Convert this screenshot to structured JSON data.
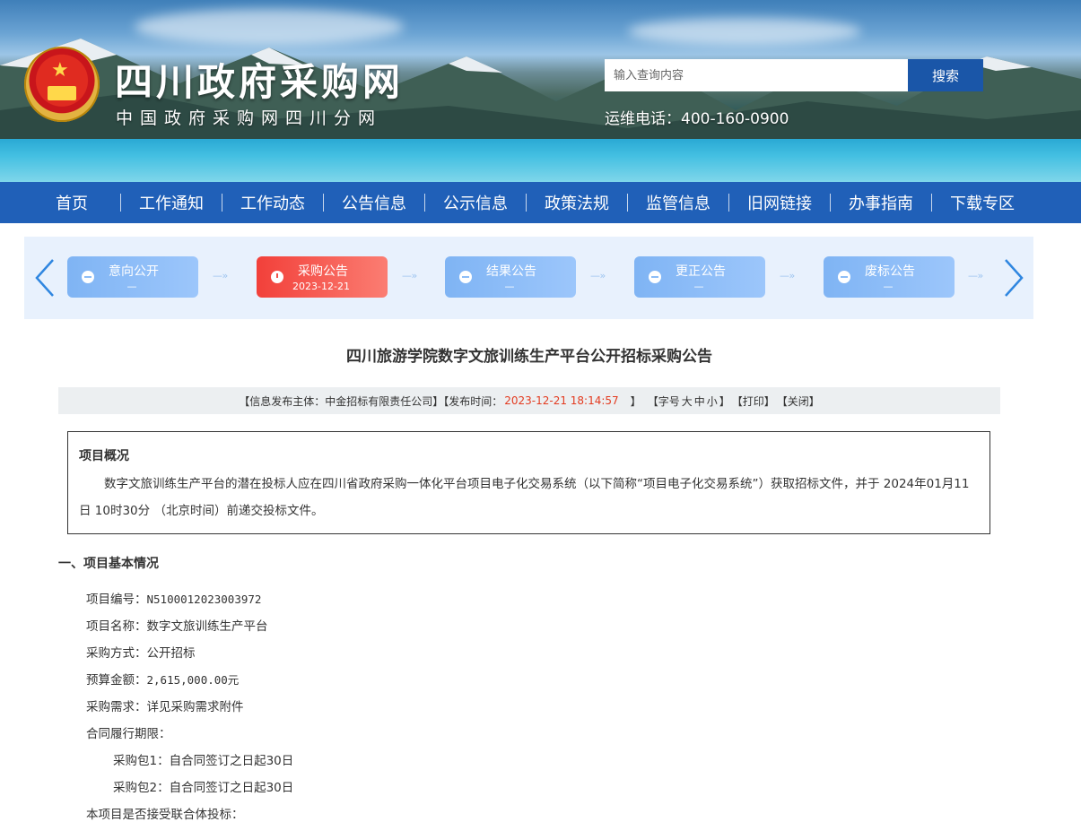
{
  "header": {
    "site_title": "四川政府采购网",
    "site_subtitle": "中国政府采购网四川分网",
    "search_placeholder": "输入查询内容",
    "search_button": "搜索",
    "hotline": "运维电话：400-160-0900"
  },
  "nav": {
    "items": [
      "首页",
      "工作通知",
      "工作动态",
      "公告信息",
      "公示信息",
      "政策法规",
      "监管信息",
      "旧网链接",
      "办事指南",
      "下载专区"
    ]
  },
  "flow": {
    "prev_icon": "chevron-left-icon",
    "next_icon": "chevron-right-icon",
    "steps": [
      {
        "label": "意向公开",
        "date": "—",
        "active": false
      },
      {
        "label": "采购公告",
        "date": "2023-12-21",
        "active": true
      },
      {
        "label": "结果公告",
        "date": "—",
        "active": false
      },
      {
        "label": "更正公告",
        "date": "—",
        "active": false
      },
      {
        "label": "废标公告",
        "date": "—",
        "active": false
      }
    ]
  },
  "article": {
    "title": "四川旅游学院数字文旅训练生产平台公开招标采购公告",
    "meta": {
      "publisher_prefix": "【信息发布主体：中金招标有限责任公司】【发布时间：",
      "publish_time": "2023-12-21 18:14:57",
      "publish_suffix": "】",
      "font_size_prefix": "【字号",
      "font_large": "大",
      "font_medium": "中",
      "font_small": "小",
      "font_size_suffix": "】",
      "print": "【打印】",
      "close": "【关闭】"
    },
    "overview": {
      "title": "项目概况",
      "text": "数字文旅训练生产平台的潜在投标人应在四川省政府采购一体化平台项目电子化交易系统（以下简称“项目电子化交易系统”）获取招标文件，并于 2024年01月11日 10时30分 （北京时间）前递交投标文件。"
    },
    "section1": {
      "heading": "一、项目基本情况",
      "project_no_label": "项目编号：",
      "project_no": "N5100012023003972",
      "project_name": "项目名称：数字文旅训练生产平台",
      "method": "采购方式：公开招标",
      "budget_label": "预算金额：",
      "budget": "2,615,000.00元",
      "requirement": "采购需求：详见采购需求附件",
      "contract_period": "合同履行期限：",
      "package1": "采购包1：自合同签订之日起30日",
      "package2": "采购包2：自合同签订之日起30日",
      "consortium": "本项目是否接受联合体投标："
    }
  }
}
